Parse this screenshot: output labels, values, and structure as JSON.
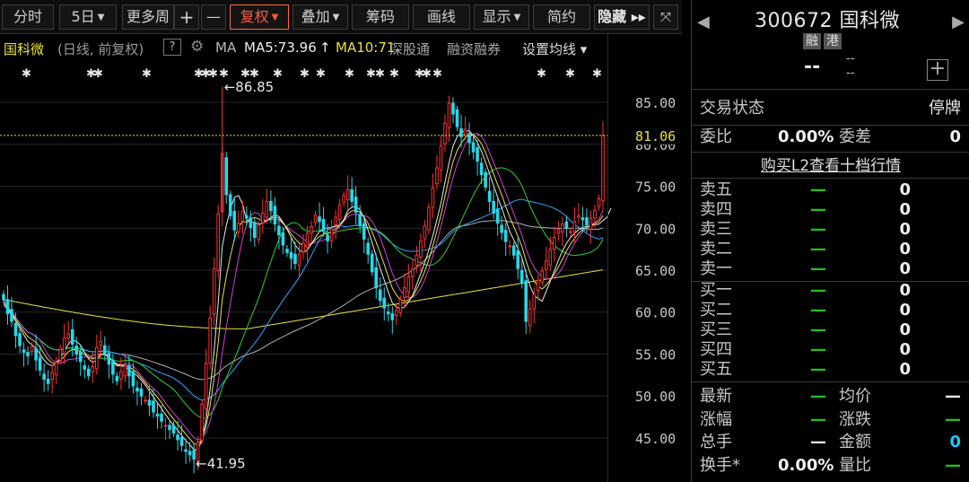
{
  "toolbar": {
    "items": [
      {
        "label": "分时",
        "caret": false
      },
      {
        "label": "5日",
        "caret": true
      },
      {
        "label": "更多周",
        "caret": false
      },
      {
        "label": "+",
        "caret": false
      },
      {
        "label": "—",
        "caret": false
      },
      {
        "label": "复权",
        "caret": true,
        "active": true
      },
      {
        "label": "叠加",
        "caret": true
      },
      {
        "label": "筹码",
        "caret": false
      },
      {
        "label": "画线",
        "caret": false
      },
      {
        "label": "显示",
        "caret": true
      },
      {
        "label": "简约",
        "caret": false
      },
      {
        "label": "隐藏 ▸▸",
        "caret": false
      },
      {
        "label": "⤧",
        "caret": false
      }
    ]
  },
  "chart_info": {
    "name": "国科微",
    "mode": "(日线, 前复权)",
    "help": "?",
    "gear_icon": "gear-icon",
    "ma_label": "MA",
    "ma5": "MA5:73.96",
    "arrow": "↑",
    "ma10": "MA10:71",
    "hk_connect": "深股通",
    "margin": "融资融券",
    "set_ma": "设置均线 ▾"
  },
  "chart_data": {
    "type": "candlestick",
    "y_axis_ticks": [
      "85.00",
      "80.00",
      "75.00",
      "70.00",
      "65.00",
      "60.00",
      "55.00",
      "50.00",
      "45.00"
    ],
    "ylim": [
      42,
      88
    ],
    "current_price_label": "81.06",
    "current_price": 81.06,
    "high_annotation": "←86.85",
    "high_value": 86.85,
    "low_annotation": "←41.95",
    "low_value": 41.95,
    "marker_rows": "✱",
    "colors": {
      "up": "#ff3030",
      "down": "#26d8e8",
      "ma5": "#e8e8e8",
      "ma10": "#e8e23a",
      "ma20": "#d040d0",
      "ma30": "#30d030",
      "ma60": "#2aa8ff",
      "ma120": "#b0b0b0",
      "ma250": "#e8e23a",
      "price_line": "#e8e23a"
    },
    "closes": [
      61.5,
      59.8,
      58.9,
      57.2,
      56.0,
      55.2,
      54.8,
      55.9,
      54.3,
      53.1,
      52.0,
      51.5,
      52.8,
      54.0,
      55.6,
      56.9,
      57.4,
      56.2,
      55.0,
      54.1,
      53.2,
      52.4,
      53.5,
      55.8,
      56.5,
      55.1,
      53.8,
      52.6,
      51.8,
      52.9,
      53.6,
      52.4,
      51.2,
      50.6,
      50.0,
      49.5,
      48.9,
      48.1,
      47.6,
      47.0,
      46.5,
      46.0,
      45.6,
      44.8,
      44.1,
      43.4,
      43.0,
      42.5,
      44.5,
      49.0,
      53.9,
      59.3,
      65.2,
      71.7,
      78.9,
      74.0,
      71.5,
      69.8,
      70.6,
      72.0,
      71.2,
      70.1,
      68.9,
      70.4,
      71.8,
      73.2,
      72.1,
      70.5,
      69.2,
      68.0,
      67.1,
      66.4,
      65.8,
      66.9,
      68.2,
      69.4,
      70.2,
      71.6,
      70.8,
      69.7,
      68.5,
      69.9,
      71.3,
      72.8,
      73.9,
      74.6,
      73.2,
      71.9,
      70.3,
      68.7,
      66.9,
      64.8,
      62.9,
      61.4,
      60.5,
      59.8,
      59.1,
      60.2,
      61.5,
      62.9,
      64.2,
      65.1,
      66.8,
      68.5,
      70.3,
      72.5,
      74.8,
      77.2,
      79.8,
      82.5,
      84.9,
      83.6,
      82.1,
      80.9,
      81.8,
      80.2,
      79.1,
      78.0,
      76.4,
      74.9,
      73.2,
      71.8,
      70.6,
      69.5,
      68.4,
      67.9,
      66.8,
      65.2,
      63.5,
      58.9,
      60.4,
      62.1,
      63.8,
      64.9,
      66.1,
      67.5,
      68.9,
      69.8,
      70.5,
      70.0,
      69.6,
      70.8,
      71.5,
      71.0,
      70.4,
      71.2,
      72.1,
      73.5,
      81.06
    ],
    "ma5": [
      60.9,
      60.3,
      59.7,
      58.9,
      58.1,
      57.3,
      56.5,
      56.1,
      55.7,
      55.0,
      54.3,
      53.8,
      53.6,
      53.9,
      54.6,
      55.3,
      56.2,
      56.7,
      56.5,
      56.1,
      55.2,
      54.4,
      54.0,
      54.3,
      54.9,
      55.0,
      54.7,
      54.1,
      53.6,
      53.6,
      53.5,
      53.1,
      52.8,
      52.4,
      51.9,
      51.3,
      50.6,
      49.9,
      49.2,
      48.5,
      47.8,
      47.1,
      46.5,
      45.9,
      45.3,
      44.7,
      44.2,
      43.6,
      43.6,
      44.8,
      47.2,
      50.8,
      55.4,
      61.1,
      67.8,
      70.3,
      72.3,
      73.7,
      73.9,
      72.9,
      71.0,
      70.7,
      70.7,
      70.5,
      70.6,
      70.9,
      71.3,
      71.6,
      71.4,
      70.7,
      69.9,
      68.9,
      68.0,
      67.4,
      67.1,
      67.4,
      68.1,
      68.9,
      69.6,
      70.0,
      70.0,
      70.1,
      70.2,
      70.4,
      71.0,
      72.1,
      72.5,
      72.6,
      72.2,
      71.2,
      69.8,
      68.3,
      66.7,
      65.2,
      63.8,
      62.4,
      61.1,
      60.6,
      60.4,
      60.6,
      61.2,
      62.0,
      63.3,
      64.6,
      65.9,
      67.4,
      69.1,
      71.0,
      73.0,
      75.5,
      77.8,
      79.8,
      80.9,
      81.4,
      81.6,
      81.6,
      81.0,
      80.2,
      79.2,
      77.9,
      76.5,
      75.1,
      73.7,
      72.4,
      71.0,
      69.6,
      68.6,
      67.6,
      66.5,
      64.7,
      63.1,
      62.0,
      61.6,
      61.3,
      62.5,
      63.7,
      64.9,
      66.2,
      67.3,
      68.2,
      68.9,
      69.4,
      69.8,
      70.1,
      70.2,
      70.3,
      70.4,
      70.5,
      70.9,
      71.3,
      72.4
    ],
    "hk_markers_text": "✱"
  },
  "right_panel": {
    "code": "300672",
    "name": "国科微",
    "tags": [
      "融",
      "港"
    ],
    "price": "--",
    "change_a": "--",
    "change_b": "--",
    "add_button": "+",
    "status_label": "交易状态",
    "status_value": "停牌",
    "bid_ratio_label": "委比",
    "bid_ratio_value": "0.00%",
    "bid_diff_label": "委差",
    "bid_diff_value": "0",
    "l2_link": "购买L2查看十档行情",
    "sell": [
      {
        "label": "卖五",
        "price": "—",
        "vol": "0"
      },
      {
        "label": "卖四",
        "price": "—",
        "vol": "0"
      },
      {
        "label": "卖三",
        "price": "—",
        "vol": "0"
      },
      {
        "label": "卖二",
        "price": "—",
        "vol": "0"
      },
      {
        "label": "卖一",
        "price": "—",
        "vol": "0"
      }
    ],
    "buy": [
      {
        "label": "买一",
        "price": "—",
        "vol": "0"
      },
      {
        "label": "买二",
        "price": "—",
        "vol": "0"
      },
      {
        "label": "买三",
        "price": "—",
        "vol": "0"
      },
      {
        "label": "买四",
        "price": "—",
        "vol": "0"
      },
      {
        "label": "买五",
        "price": "—",
        "vol": "0"
      }
    ],
    "stats": [
      {
        "l1": "最新",
        "v1": "—",
        "l2": "均价",
        "v2": "—"
      },
      {
        "l1": "涨幅",
        "v1": "—",
        "l2": "涨跌",
        "v2": "—"
      },
      {
        "l1": "总手",
        "v1": "—",
        "l2": "金额",
        "v2": "0"
      },
      {
        "l1": "换手*",
        "v1": "0.00%",
        "l2": "量比",
        "v2": "—"
      }
    ]
  }
}
